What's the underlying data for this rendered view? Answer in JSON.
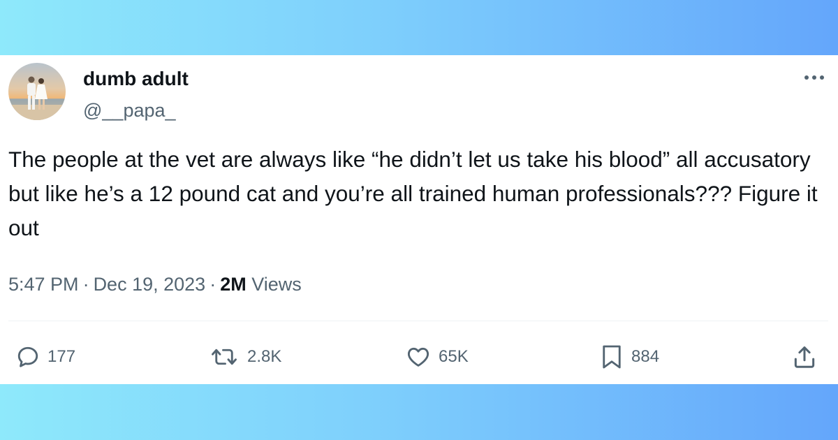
{
  "tweet": {
    "author": {
      "display_name": "dumb adult",
      "handle": "@__papa_"
    },
    "text": "The people at the vet are always like “he didn’t let us take his blood” all accusatory but like he’s a 12 pound cat and you’re all trained human professionals??? Figure it out",
    "time": "5:47 PM",
    "date": "Dec 19, 2023",
    "separator": "·",
    "views_count": "2M",
    "views_label": "Views",
    "actions": {
      "replies": "177",
      "reposts": "2.8K",
      "likes": "65K",
      "bookmarks": "884"
    },
    "icons": {
      "more": "more-icon",
      "reply": "reply-icon",
      "repost": "repost-icon",
      "like": "heart-icon",
      "bookmark": "bookmark-icon",
      "share": "share-icon"
    }
  },
  "colors": {
    "background_gradient_start": "#8ee9fb",
    "background_gradient_end": "#64a6fb",
    "card": "#ffffff",
    "text_primary": "#0f1419",
    "text_secondary": "#536471"
  }
}
